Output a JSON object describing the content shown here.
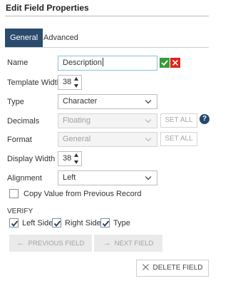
{
  "dialog": {
    "title": "Edit Field Properties"
  },
  "tabs": [
    {
      "label": "General",
      "active": true
    },
    {
      "label": "Advanced",
      "active": false
    }
  ],
  "form": {
    "name": {
      "label": "Name",
      "value": "Description"
    },
    "template_width": {
      "label": "Template Width",
      "value": "38"
    },
    "type": {
      "label": "Type",
      "value": "Character"
    },
    "decimals": {
      "label": "Decimals",
      "value": "Floating",
      "set_all": "SET ALL",
      "help": "?"
    },
    "format": {
      "label": "Format",
      "value": "General",
      "set_all": "SET ALL"
    },
    "display_width": {
      "label": "Display Width",
      "value": "38"
    },
    "alignment": {
      "label": "Alignment",
      "value": "Left"
    },
    "copy_value": {
      "label": "Copy Value from Previous Record",
      "checked": false
    }
  },
  "verify": {
    "heading": "VERIFY",
    "left_side": {
      "label": "Left Side",
      "checked": true
    },
    "right_side": {
      "label": "Right Side",
      "checked": true
    },
    "type": {
      "label": "Type",
      "checked": true
    }
  },
  "buttons": {
    "previous_field": "PREVIOUS FIELD",
    "next_field": "NEXT FIELD",
    "delete_field": "DELETE FIELD"
  },
  "colors": {
    "tab_active": "#2b4b6e",
    "confirm": "#3a9a3a",
    "cancel": "#e2231a",
    "help": "#25476d"
  }
}
